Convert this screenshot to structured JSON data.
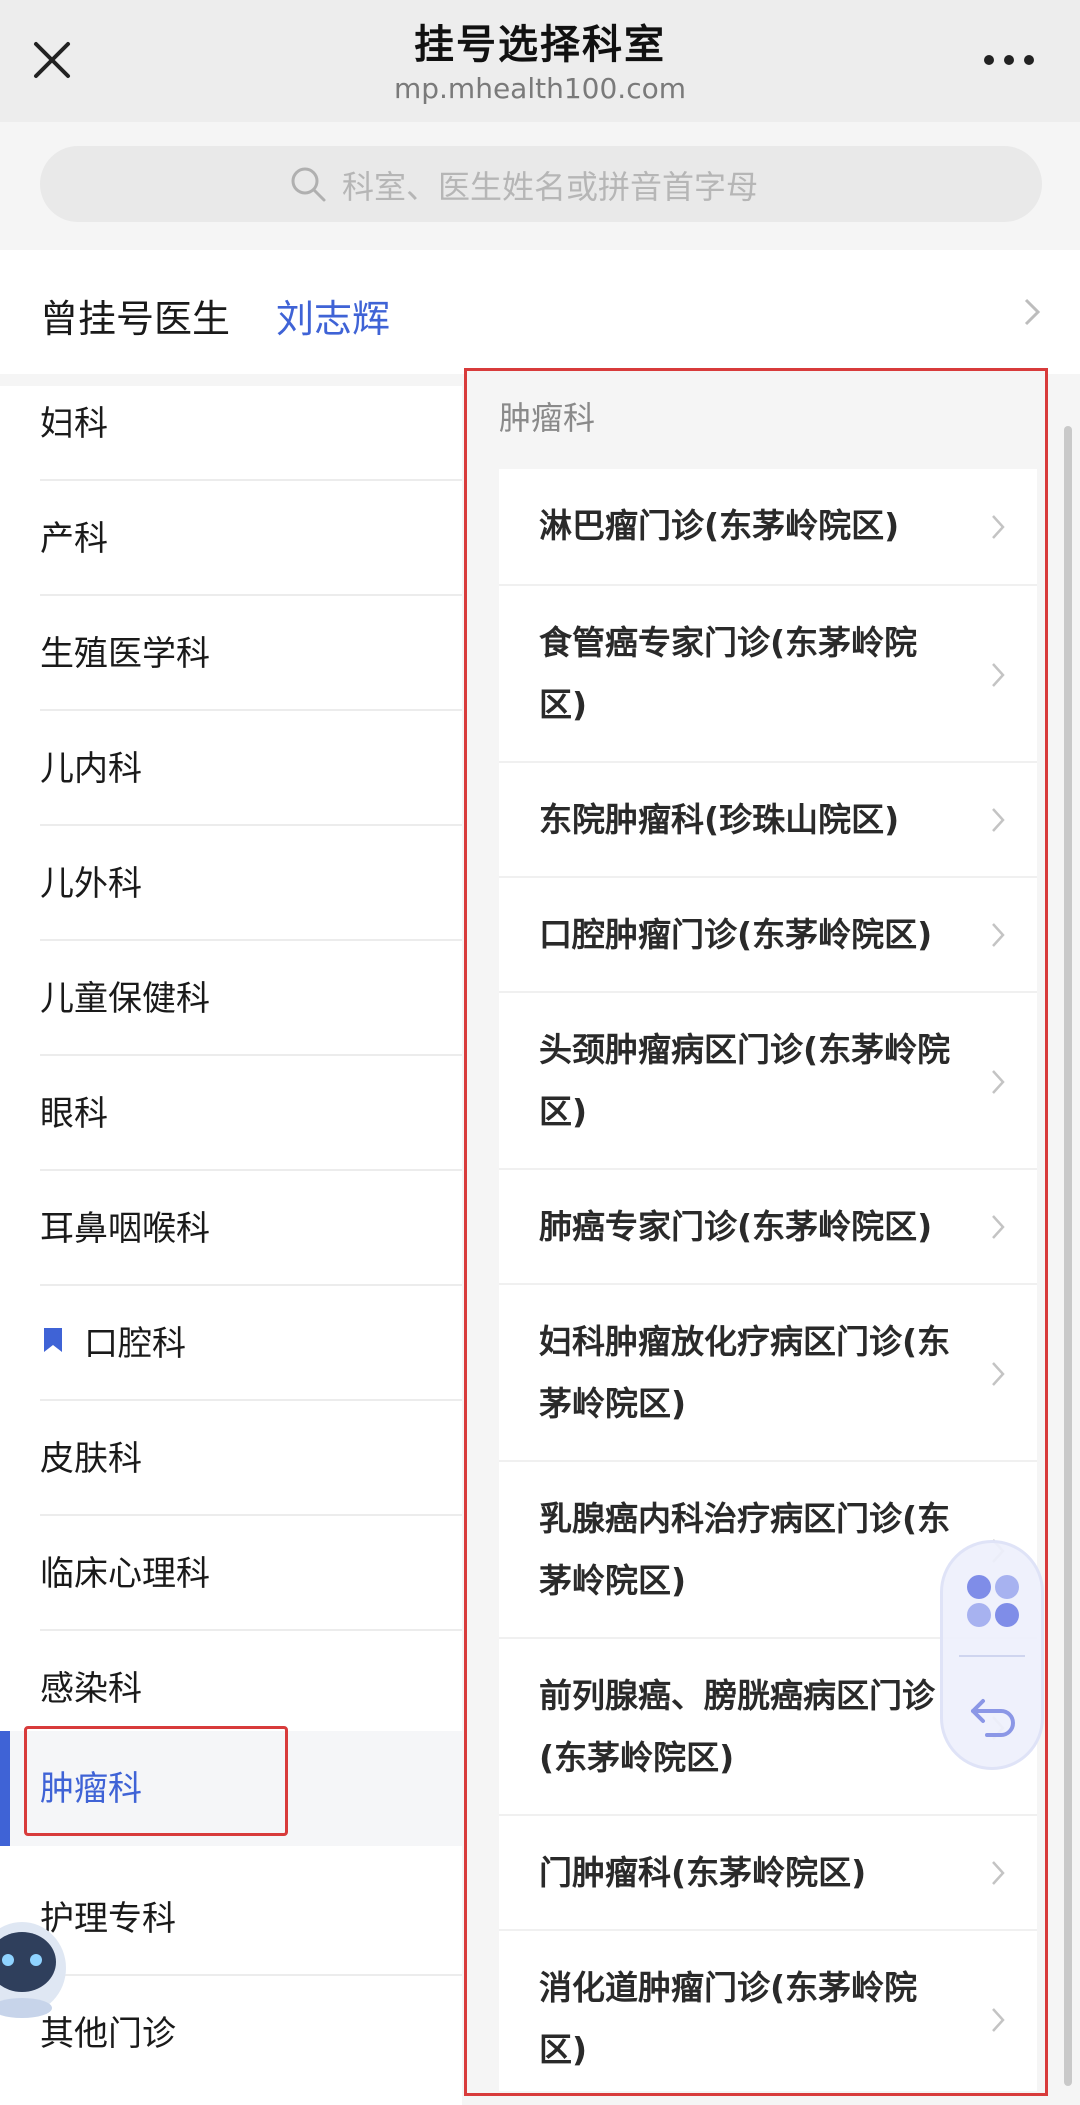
{
  "header": {
    "title": "挂号选择科室",
    "domain": "mp.mhealth100.com",
    "close_icon": "close-icon",
    "more_icon": "more-icon"
  },
  "search": {
    "placeholder": "科室、医生姓名或拼音首字母",
    "icon": "search-icon"
  },
  "previous": {
    "label": "曾挂号医生",
    "doctor": "刘志辉"
  },
  "departments": [
    {
      "label": "妇科"
    },
    {
      "label": "产科"
    },
    {
      "label": "生殖医学科"
    },
    {
      "label": "儿内科"
    },
    {
      "label": "儿外科"
    },
    {
      "label": "儿童保健科"
    },
    {
      "label": "眼科"
    },
    {
      "label": "耳鼻咽喉科"
    },
    {
      "label": "口腔科",
      "bookmark": true
    },
    {
      "label": "皮肤科"
    },
    {
      "label": "临床心理科"
    },
    {
      "label": "感染科"
    },
    {
      "label": "肿瘤科",
      "active": true
    },
    {
      "label": "护理专科"
    },
    {
      "label": "其他门诊"
    }
  ],
  "section": {
    "title": "肿瘤科",
    "clinics": [
      {
        "label": "淋巴瘤门诊(东茅岭院区)"
      },
      {
        "label": "食管癌专家门诊(东茅岭院区)"
      },
      {
        "label": "东院肿瘤科(珍珠山院区)"
      },
      {
        "label": "口腔肿瘤门诊(东茅岭院区)"
      },
      {
        "label": "头颈肿瘤病区门诊(东茅岭院区)"
      },
      {
        "label": "肺癌专家门诊(东茅岭院区)"
      },
      {
        "label": "妇科肿瘤放化疗病区门诊(东茅岭院区)"
      },
      {
        "label": "乳腺癌内科治疗病区门诊(东茅岭院区)"
      },
      {
        "label": "前列腺癌、膀胱癌病区门诊(东茅岭院区)"
      },
      {
        "label": "门肿瘤科(东茅岭院区)"
      },
      {
        "label": "消化道肿瘤门诊(东茅岭院区)"
      }
    ]
  },
  "colors": {
    "accent": "#3f63d6",
    "highlight_box": "#d83b3b"
  }
}
